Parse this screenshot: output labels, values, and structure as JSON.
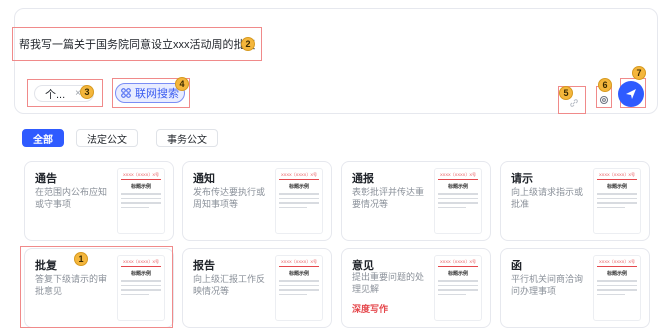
{
  "input": {
    "prompt": "帮我写一篇关于国务院同意设立xxx活动周的批复",
    "chip_label": "个...",
    "chip_close": "×",
    "web_search_label": "联网搜索"
  },
  "badges": {
    "b1": "1",
    "b2": "2",
    "b3": "3",
    "b4": "4",
    "b5": "5",
    "b6": "6",
    "b7": "7"
  },
  "tabs": [
    {
      "label": "全部",
      "active": true
    },
    {
      "label": "法定公文",
      "active": false
    },
    {
      "label": "事务公文",
      "active": false
    }
  ],
  "thumb": {
    "head": "XXXX〔XXXX〕X号",
    "title": "标题示例"
  },
  "cards": [
    {
      "title": "通告",
      "desc": "在范围内公布应知或守事项"
    },
    {
      "title": "通知",
      "desc": "发布传达要执行或周知事项等"
    },
    {
      "title": "通报",
      "desc": "表彰批评并传达重要情况等"
    },
    {
      "title": "请示",
      "desc": "向上级请求指示或批准"
    },
    {
      "title": "批复",
      "desc": "答复下级请示的审批意见"
    },
    {
      "title": "报告",
      "desc": "向上级汇报工作反映情况等"
    },
    {
      "title": "意见",
      "desc": "提出重要问题的处理见解",
      "extra": "深度写作"
    },
    {
      "title": "函",
      "desc": "平行机关间商洽询问办理事项"
    }
  ],
  "colors": {
    "accent": "#2f5bff",
    "highlight": "#f08a8a",
    "badge": "#f4b63c",
    "extra": "#e5484d"
  }
}
